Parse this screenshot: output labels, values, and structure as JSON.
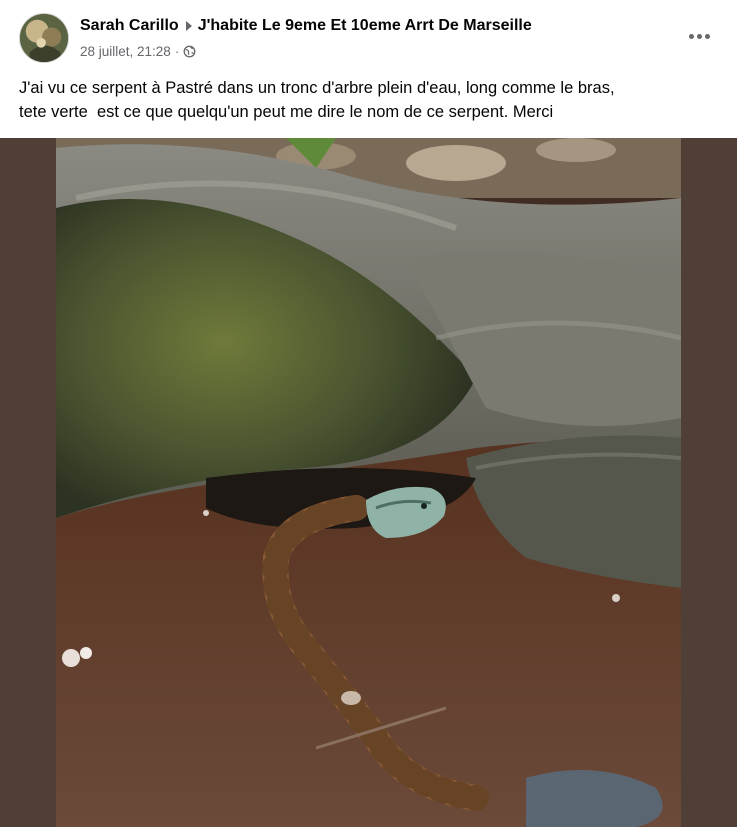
{
  "post": {
    "author": "Sarah Carillo",
    "group": "J'habite Le 9eme Et 10eme Arrt De Marseille",
    "timestamp": "28 juillet, 21:28",
    "separator": "·",
    "privacy_icon": "globe-icon",
    "more_icon": "more-options-icon",
    "text_lines": [
      "J'ai vu ce serpent à Pastré dans un tronc d'arbre plein d'eau, long comme le bras,",
      "tete verte  est ce que quelqu'un peut me dire le nom de ce serpent. Merci"
    ]
  },
  "colors": {
    "media_background": "#4f3f36",
    "secondary_text": "#65676b",
    "primary_text": "#050505"
  }
}
